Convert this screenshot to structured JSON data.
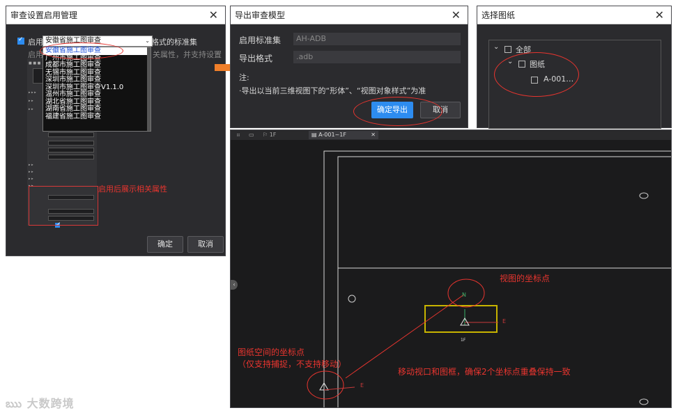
{
  "dialog1": {
    "title": "审查设置启用管理",
    "close": "✕",
    "enable_label": "启用",
    "dropdown_value": "安徽省施工图审查",
    "options": [
      "安徽省施工图审查",
      "广州市施工图审查",
      "成都市施工图审查",
      "无锡市施工图审查",
      "深圳市施工图审查",
      "深圳市施工图审查V1.1.0",
      "温州市施工图审查",
      "湖北省施工图审查",
      "湖南省施工图审查",
      "福建省施工图审查"
    ],
    "desc_1": "格式的标准集",
    "desc_2_left": "启用",
    "desc_2_right": "关属性，并支持设置",
    "panel_note": "启用后展示相关属性",
    "ok": "确定",
    "cancel": "取消"
  },
  "dialog2": {
    "title": "导出审查模型",
    "close": "✕",
    "standard_label": "启用标准集",
    "standard_value": "AH-ADB",
    "format_label": "导出格式",
    "format_value": ".adb",
    "note_label": "注:",
    "note_text": "·导出以当前三维视图下的“形体”、“视图对象样式”为准",
    "confirm": "确定导出",
    "cancel": "取消"
  },
  "dialog3": {
    "title": "选择图纸",
    "close": "✕",
    "tree": {
      "all": "全部",
      "drawings": "图纸",
      "sheet": "A-001…"
    }
  },
  "viewport": {
    "tab_1f": "1F",
    "tab_sheet": "A-001~1F",
    "tab_close": "✕",
    "north": "N",
    "east": "E",
    "label_1f": "1F",
    "ann_view_point": "视图的坐标点",
    "ann_sheet_point": "图纸空间的坐标点",
    "ann_sheet_point_note": "（仅支持捕捉，不支持移动）",
    "ann_move": "移动视口和图框，确保2个坐标点重叠保持一致"
  },
  "watermark": "大数跨境",
  "colors": {
    "accent": "#2d8cf0",
    "annotation": "#e8352f",
    "highlight": "#c8b400",
    "arrow": "#f07f2a"
  }
}
